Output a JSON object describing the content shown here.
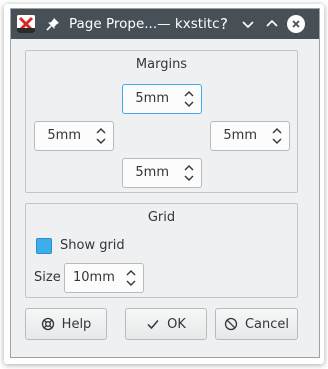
{
  "window": {
    "title": "Page Prope...— kxstitch",
    "help_glyph": "?"
  },
  "margins": {
    "title": "Margins",
    "top": "5mm",
    "left": "5mm",
    "right": "5mm",
    "bottom": "5mm"
  },
  "grid": {
    "title": "Grid",
    "show_grid_label": "Show grid",
    "show_grid_checked": true,
    "size_label": "Size",
    "size_value": "10mm"
  },
  "buttons": {
    "help": "Help",
    "ok": "OK",
    "cancel": "Cancel"
  },
  "colors": {
    "titlebar": "#475057",
    "accent": "#3daee9",
    "window_bg": "#eff0f1"
  },
  "icons": {
    "app": "kxstitch-icon",
    "pin": "pin-icon",
    "help": "help-icon",
    "minimize": "chevron-down-icon",
    "maximize": "chevron-up-icon",
    "close": "close-icon",
    "help_button": "life-ring-icon",
    "ok_button": "check-icon",
    "cancel_button": "cancel-icon"
  }
}
